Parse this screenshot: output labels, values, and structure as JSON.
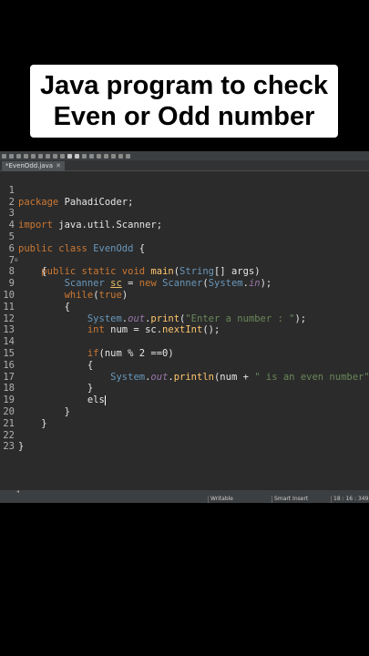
{
  "title": {
    "line1": "Java program to check",
    "line2": "Even or Odd number"
  },
  "editor": {
    "tab_label": "*EvenOdd.java",
    "tab_close": "✕",
    "lines": [
      {
        "n": "1"
      },
      {
        "n": "2"
      },
      {
        "n": "3"
      },
      {
        "n": "4"
      },
      {
        "n": "5"
      },
      {
        "n": "6"
      },
      {
        "n": "7"
      },
      {
        "n": "8"
      },
      {
        "n": "9"
      },
      {
        "n": "10"
      },
      {
        "n": "11"
      },
      {
        "n": "12"
      },
      {
        "n": "13"
      },
      {
        "n": "14"
      },
      {
        "n": "15"
      },
      {
        "n": "16"
      },
      {
        "n": "17"
      },
      {
        "n": "18"
      },
      {
        "n": "19"
      },
      {
        "n": "20"
      },
      {
        "n": "21"
      },
      {
        "n": "22"
      },
      {
        "n": "23"
      }
    ],
    "code": {
      "l1_kw": "package",
      "l1_rest": " PahadiCoder;",
      "l3_kw": "import",
      "l3_rest": " java.util.Scanner;",
      "l5_kw": "public class",
      "l5_cls": "EvenOdd",
      "l5_rest": " {",
      "l6_kw": "public static void",
      "l6_fn": "main",
      "l6_p1": "(",
      "l6_cls": "String",
      "l6_p2": "[] ",
      "l6_var": "args",
      "l6_p3": ")",
      "l7": "{",
      "l8_cls1": "Scanner",
      "l8_var": "sc",
      "l8_p1": " = ",
      "l8_kw": "new",
      "l8_cls2": "Scanner",
      "l8_p2": "(",
      "l8_cls3": "System",
      "l8_p3": ".",
      "l8_fld": "in",
      "l8_p4": ");",
      "l9_kw": "while",
      "l9_p1": "(",
      "l9_kw2": "true",
      "l9_p2": ")",
      "l10": "{",
      "l11_cls": "System",
      "l11_p1": ".",
      "l11_fld": "out",
      "l11_p2": ".",
      "l11_fn": "print",
      "l11_p3": "(",
      "l11_str": "\"Enter a number : \"",
      "l11_p4": ");",
      "l12_kw": "int",
      "l12_rest": " num = sc.",
      "l12_fn": "nextInt",
      "l12_p": "();",
      "l14_kw": "if",
      "l14_rest": "(num % 2 ==0)",
      "l15": "{",
      "l16_cls": "System",
      "l16_p1": ".",
      "l16_fld": "out",
      "l16_p2": ".",
      "l16_fn": "println",
      "l16_p3": "(num + ",
      "l16_str": "\" is an even number\"",
      "l16_p4": ");",
      "l17": "}",
      "l18": "els",
      "l19": "}",
      "l20": "}",
      "l22": "}"
    }
  },
  "status": {
    "writable": "Writable",
    "insert_mode": "Smart Insert",
    "position": "18 : 16 : 349"
  },
  "colors": {
    "background": "#000000",
    "editor_bg": "#2b2b2b",
    "keyword": "#cc7832",
    "class": "#6897bb",
    "string": "#6a8759"
  }
}
